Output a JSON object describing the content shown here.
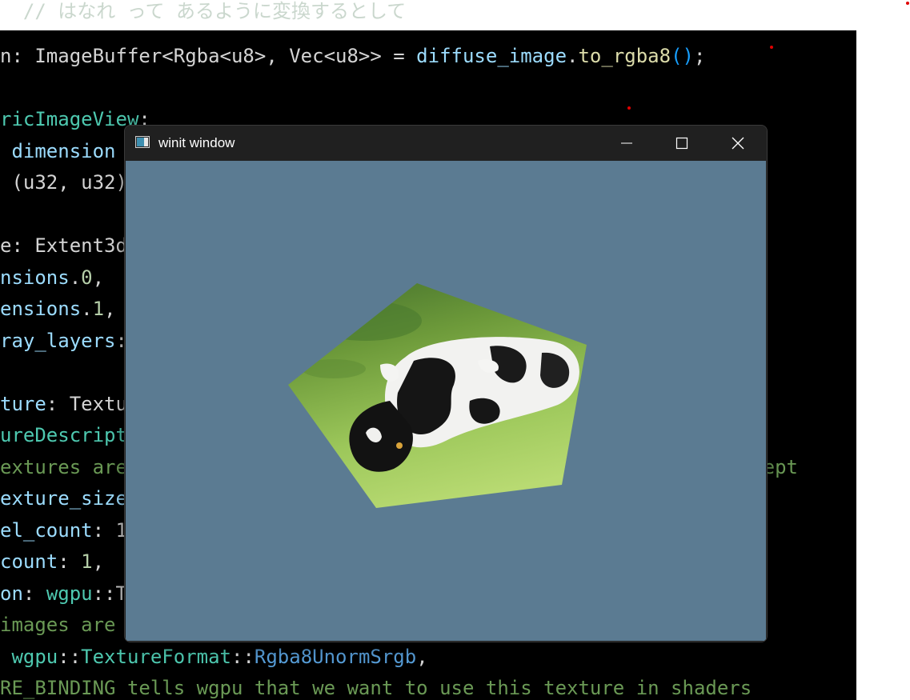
{
  "background_code": {
    "top_faded": "  // はなれ って あるように変換するとして",
    "lines": [
      [
        [
          "n: ImageBuffer<Rgba<u8>, Vec<u8>> = ",
          "white"
        ],
        [
          "diffuse_image",
          "cyan"
        ],
        [
          ".",
          "white"
        ],
        [
          "to_rgba8",
          "yellow"
        ],
        [
          "()",
          "brace"
        ],
        [
          ";",
          "white"
        ]
      ],
      [],
      [
        [
          "ricImageView",
          "teal"
        ],
        [
          ":",
          "white"
        ]
      ],
      [
        [
          " dimension",
          "cyan"
        ]
      ],
      [
        [
          " (u32, u32)",
          "white"
        ]
      ],
      [],
      [
        [
          "e: Extent3d",
          "white"
        ]
      ],
      [
        [
          "nsions",
          "cyan"
        ],
        [
          ".",
          "white"
        ],
        [
          "0",
          "num"
        ],
        [
          ",",
          "white"
        ]
      ],
      [
        [
          "ensions",
          "cyan"
        ],
        [
          ".",
          "white"
        ],
        [
          "1",
          "num"
        ],
        [
          ",",
          "white"
        ]
      ],
      [
        [
          "ray_layers",
          "cyan"
        ],
        [
          ":",
          "white"
        ]
      ],
      [],
      [
        [
          "ture",
          "cyan"
        ],
        [
          ": Textu",
          "white"
        ]
      ],
      [
        [
          "ureDescriptor",
          "teal"
        ]
      ],
      [
        [
          "extures are",
          "comment"
        ],
        [
          "                                                  ing dept",
          "comment"
        ]
      ],
      [
        [
          "exture_size",
          "cyan"
        ]
      ],
      [
        [
          "el_count",
          "cyan"
        ],
        [
          ": 1",
          "white"
        ]
      ],
      [
        [
          "count",
          "cyan"
        ],
        [
          ": ",
          "white"
        ],
        [
          "1",
          "num"
        ],
        [
          ",",
          "white"
        ]
      ],
      [
        [
          "on",
          "cyan"
        ],
        [
          ": ",
          "white"
        ],
        [
          "wgpu",
          "teal"
        ],
        [
          "::T",
          "white"
        ]
      ],
      [
        [
          "images are",
          "comment"
        ]
      ],
      [
        [
          " wgpu",
          "teal"
        ],
        [
          "::",
          "white"
        ],
        [
          "TextureFormat",
          "teal"
        ],
        [
          "::",
          "white"
        ],
        [
          "Rgba8UnormSrgb",
          "blue"
        ],
        [
          ",",
          "white"
        ]
      ],
      [
        [
          "RE_BINDING tells wgpu that we want to use this texture in shaders",
          "comment"
        ]
      ]
    ]
  },
  "window": {
    "title": "winit window",
    "buttons": {
      "minimize": "—",
      "maximize": "▢",
      "close": "✕"
    },
    "clear_color": "#5b7b92",
    "content": "textured pentagon showing a black-and-white cow on grass"
  },
  "colors": {
    "editor_bg": "#000000",
    "titlebar_bg": "#202020",
    "title_text": "#ffffff"
  }
}
